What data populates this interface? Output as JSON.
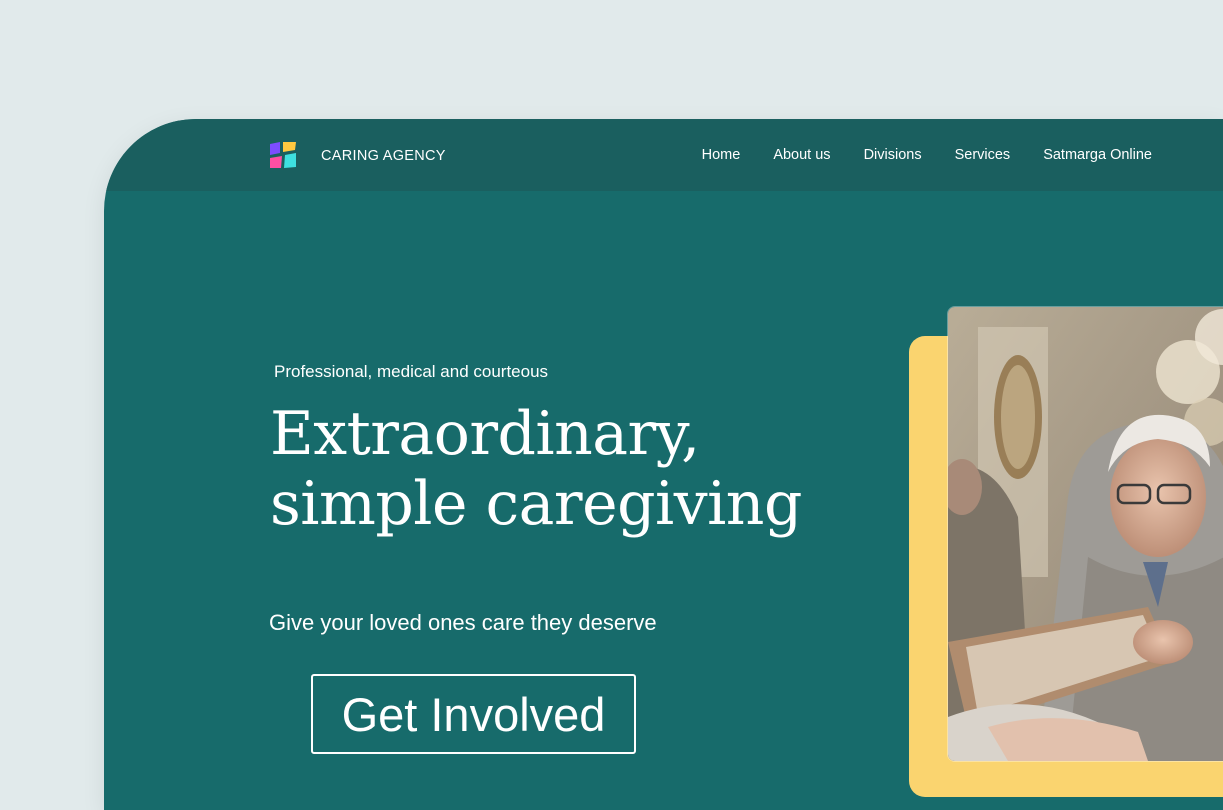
{
  "brand": {
    "name": "CARING AGENCY",
    "logo_icon": "four-petal-color-logo-icon",
    "logo_colors": [
      "#7c4dff",
      "#ff4fa3",
      "#3ee0e0",
      "#ffc940"
    ]
  },
  "nav": {
    "items": [
      {
        "label": "Home"
      },
      {
        "label": "About us"
      },
      {
        "label": "Divisions"
      },
      {
        "label": "Services"
      },
      {
        "label": "Satmarga Online"
      }
    ]
  },
  "hero": {
    "eyebrow": "Professional, medical and courteous",
    "headline_line1": "Extraordinary,",
    "headline_line2": "simple caregiving",
    "subtext": "Give your loved ones care they deserve",
    "cta_label": "Get Involved"
  },
  "image": {
    "alt": "Elderly man smiling and looking at a framed picture"
  },
  "colors": {
    "page_background": "#e1eaeb",
    "hero_background": "#176b6b",
    "navbar_background": "#1a5f5f",
    "accent_yellow": "#fad46f",
    "text": "#ffffff"
  }
}
